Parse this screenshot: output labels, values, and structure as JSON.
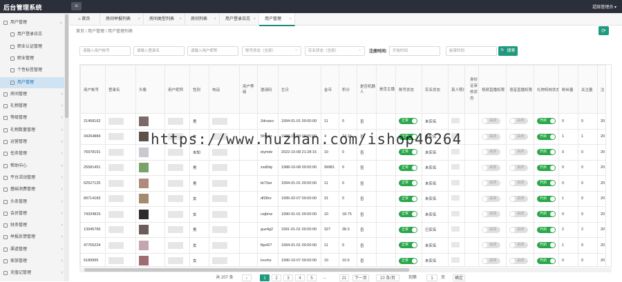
{
  "topbar": {
    "title": "后台管理系统",
    "menu_icon": "menu-icon",
    "user": "超级管理员 ▾"
  },
  "sidebar": {
    "items": [
      {
        "label": "用户管理",
        "sub": false,
        "arrow": "⌄",
        "active": false
      },
      {
        "label": "用户登录日志",
        "sub": true,
        "arrow": "",
        "active": false
      },
      {
        "label": "职业认证管理",
        "sub": true,
        "arrow": "",
        "active": false
      },
      {
        "label": "职业管理",
        "sub": true,
        "arrow": "",
        "active": false
      },
      {
        "label": "个性标签管理",
        "sub": true,
        "arrow": "",
        "active": false
      },
      {
        "label": "用户管理",
        "sub": true,
        "arrow": "",
        "active": true
      },
      {
        "label": "房间管理",
        "sub": false,
        "arrow": "‹",
        "active": false
      },
      {
        "label": "礼物管理",
        "sub": false,
        "arrow": "‹",
        "active": false
      },
      {
        "label": "等级管理",
        "sub": false,
        "arrow": "‹",
        "active": false
      },
      {
        "label": "礼物数量管理",
        "sub": false,
        "arrow": "‹",
        "active": false
      },
      {
        "label": "运营管理",
        "sub": false,
        "arrow": "‹",
        "active": false
      },
      {
        "label": "任务管理",
        "sub": false,
        "arrow": "‹",
        "active": false
      },
      {
        "label": "帮助中心",
        "sub": false,
        "arrow": "‹",
        "active": false
      },
      {
        "label": "平台活动管理",
        "sub": false,
        "arrow": "‹",
        "active": false
      },
      {
        "label": "基础消费管理",
        "sub": false,
        "arrow": "‹",
        "active": false
      },
      {
        "label": "头条管理",
        "sub": false,
        "arrow": "‹",
        "active": false
      },
      {
        "label": "会员管理",
        "sub": false,
        "arrow": "‹",
        "active": false
      },
      {
        "label": "财务管理",
        "sub": false,
        "arrow": "‹",
        "active": false
      },
      {
        "label": "举报反馈管理",
        "sub": false,
        "arrow": "‹",
        "active": false
      },
      {
        "label": "渠道管理",
        "sub": false,
        "arrow": "‹",
        "active": false
      },
      {
        "label": "家族管理",
        "sub": false,
        "arrow": "‹",
        "active": false
      },
      {
        "label": "充值记管理",
        "sub": false,
        "arrow": "‹",
        "active": false
      }
    ]
  },
  "tabs": [
    {
      "label": "首页",
      "close": "",
      "active": false
    },
    {
      "label": "房间举报列表",
      "close": "×",
      "active": false
    },
    {
      "label": "房间类型列表",
      "close": "×",
      "active": false
    },
    {
      "label": "房间列表",
      "close": "×",
      "active": false
    },
    {
      "label": "用户登录日志",
      "close": "×",
      "active": false
    },
    {
      "label": "用户管理",
      "close": "×",
      "active": true
    }
  ],
  "breadcrumb": "首页  /  用户管理  /  用户管理列表",
  "filters": [
    {
      "placeholder": "请输入用户帐号",
      "select": false
    },
    {
      "placeholder": "请输入登录名",
      "select": false
    },
    {
      "placeholder": "请输入用户昵称",
      "select": false
    },
    {
      "placeholder": "账号状态（全部）",
      "select": true
    },
    {
      "placeholder": "实名状态（全部）",
      "select": true
    },
    {
      "placeholder": "开始时间",
      "select": false
    },
    {
      "placeholder": "结束时间",
      "select": false
    }
  ],
  "time_label": "注册时间:",
  "search_label": "🔍 搜索",
  "refresh_icon": "refresh-icon",
  "table": {
    "headers": [
      "用户帐号",
      "登录名",
      "头像",
      "用户昵称",
      "性别",
      "电话",
      "用户等级",
      "邀请码",
      "生日",
      "金币",
      "积分",
      "是否机器人",
      "是否主播",
      "账号状态",
      "实名状态",
      "真人照片",
      "身份证审核状态",
      "视频直播权限",
      "语音直播权限",
      "礼物特效状态",
      "粉丝量",
      "关注量",
      "注"
    ],
    "rows": [
      {
        "account": "21458162",
        "gender": "男",
        "invite": "2drsavv",
        "birthday": "1994-01-01 00:00:00",
        "coins": "11",
        "points": "0",
        "robot": "否",
        "status": "正常",
        "real": "未实名",
        "video": "关闭",
        "voice": "关闭",
        "gift": "开启",
        "fans": "0",
        "follow": "0",
        "reg": "20"
      },
      {
        "account": "34264884",
        "gender": "女",
        "invite": "5lhedo",
        "birthday": "1988-10-08 00:00:00",
        "coins": "4",
        "points": "74.15",
        "robot": "否",
        "status": "正常",
        "real": "未实名",
        "video": "关闭",
        "voice": "关闭",
        "gift": "开启",
        "fans": "1",
        "follow": "1",
        "reg": "20"
      },
      {
        "account": "76978191",
        "gender": "未知",
        "invite": "eiymdv",
        "birthday": "2022-10-08 21:28:15",
        "coins": "10",
        "points": "0",
        "robot": "否",
        "status": "正常",
        "real": "未实名",
        "video": "关闭",
        "voice": "关闭",
        "gift": "开启",
        "fans": "0",
        "follow": "0",
        "reg": "20"
      },
      {
        "account": "25581451",
        "gender": "男",
        "invite": "zsd0dy",
        "birthday": "1988-10-08 00:00:00",
        "coins": "99981",
        "points": "0",
        "robot": "否",
        "status": "正常",
        "real": "未实名",
        "video": "关闭",
        "voice": "关闭",
        "gift": "开启",
        "fans": "0",
        "follow": "0",
        "reg": "20"
      },
      {
        "account": "62527125",
        "gender": "男",
        "invite": "bt73wr",
        "birthday": "1994-01-01 00:00:00",
        "coins": "11",
        "points": "0",
        "robot": "否",
        "status": "正常",
        "real": "未实名",
        "video": "关闭",
        "voice": "关闭",
        "gift": "开启",
        "fans": "0",
        "follow": "0",
        "reg": "20"
      },
      {
        "account": "89714183",
        "gender": "女",
        "invite": "df28ro",
        "birthday": "1995-02-07 00:00:00",
        "coins": "31",
        "points": "0",
        "robot": "否",
        "status": "正常",
        "real": "未实名",
        "video": "关闭",
        "voice": "关闭",
        "gift": "开启",
        "fans": "1",
        "follow": "0",
        "reg": "20"
      },
      {
        "account": "74334815",
        "gender": "女",
        "invite": "cejbmz",
        "birthday": "1990-01-01 00:00:00",
        "coins": "10",
        "points": "18.75",
        "robot": "否",
        "status": "正常",
        "real": "未实名",
        "video": "关闭",
        "voice": "关闭",
        "gift": "开启",
        "fans": "0",
        "follow": "0",
        "reg": "20"
      },
      {
        "account": "13945766",
        "gender": "男",
        "invite": "guz4g2",
        "birthday": "1991-01-01 00:00:00",
        "coins": "327",
        "points": "38.3",
        "robot": "否",
        "status": "正常",
        "real": "已实名",
        "video": "关闭",
        "voice": "关闭",
        "gift": "开启",
        "fans": "2",
        "follow": "2",
        "reg": "20"
      },
      {
        "account": "47755224",
        "gender": "女",
        "invite": "fkp427",
        "birthday": "1994-01-01 00:00:00",
        "coins": "11",
        "points": "0",
        "robot": "否",
        "status": "正常",
        "real": "未实名",
        "video": "关闭",
        "voice": "关闭",
        "gift": "开启",
        "fans": "1",
        "follow": "0",
        "reg": "20"
      },
      {
        "account": "5189995",
        "gender": "女",
        "invite": "lvvvho",
        "birthday": "1990-10-07 00:00:00",
        "coins": "10",
        "points": "10.5",
        "robot": "否",
        "status": "正常",
        "real": "未实名",
        "video": "关闭",
        "voice": "关闭",
        "gift": "开启",
        "fans": "0",
        "follow": "0",
        "reg": "20"
      }
    ]
  },
  "avatar_colors": [
    "#7a6a68",
    "#5b5149",
    "#c9c9d0",
    "#7aa36a",
    "#b08a7a",
    "#a48b70",
    "#2f2a2c",
    "#6a5d5a",
    "#c4a6b0",
    "#9d6d72"
  ],
  "pagination": {
    "total": "共 207 条",
    "prev": "‹",
    "pages": [
      "1",
      "2",
      "3",
      "4",
      "5"
    ],
    "ellipsis": "...",
    "last": "21",
    "next": "下一页",
    "size": "10 条/页",
    "goto": "到第",
    "page_input": "1",
    "page_unit": "页",
    "confirm": "确定"
  },
  "watermark": "https://www.huzhan.com/ishop46264",
  "colors": {
    "primary": "#1f9a7e",
    "topbar": "#2b2f3a",
    "toggle_on": "#2aa64a"
  }
}
